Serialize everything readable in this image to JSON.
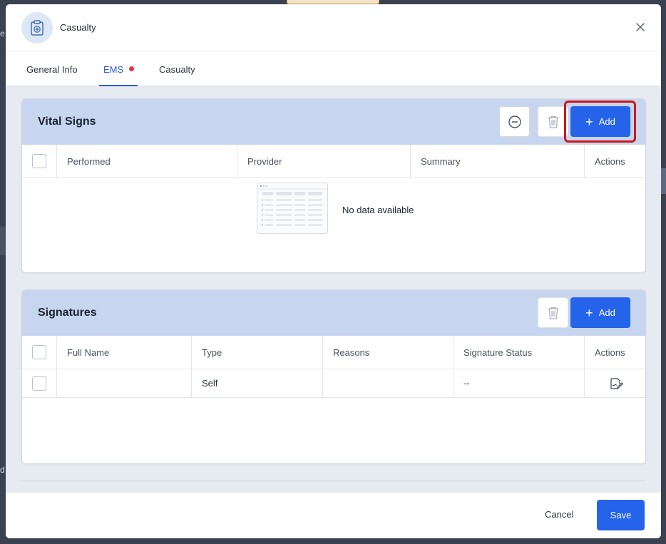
{
  "dialog": {
    "title": "Casualty",
    "icon": "clipboard-medical-icon",
    "close_icon": "close-icon"
  },
  "tabs": [
    {
      "label": "General Info",
      "active": false
    },
    {
      "label": "EMS",
      "active": true,
      "has_indicator": true
    },
    {
      "label": "Casualty",
      "active": false
    }
  ],
  "vital_signs": {
    "title": "Vital Signs",
    "add_label": "Add",
    "columns": [
      "Performed",
      "Provider",
      "Summary",
      "Actions"
    ],
    "empty_text": "No data available",
    "highlighted_button": "add"
  },
  "signatures": {
    "title": "Signatures",
    "add_label": "Add",
    "columns": [
      "Full Name",
      "Type",
      "Reasons",
      "Signature Status",
      "Actions"
    ],
    "rows": [
      {
        "full_name": "",
        "type": "Self",
        "reasons": "",
        "status": "--",
        "action_icon": "sign-document-icon"
      }
    ]
  },
  "footer": {
    "cancel_label": "Cancel",
    "save_label": "Save"
  },
  "colors": {
    "primary": "#2563eb",
    "card_header": "#c7d6ee",
    "highlight": "#d0141e",
    "indicator": "#e0344a"
  }
}
